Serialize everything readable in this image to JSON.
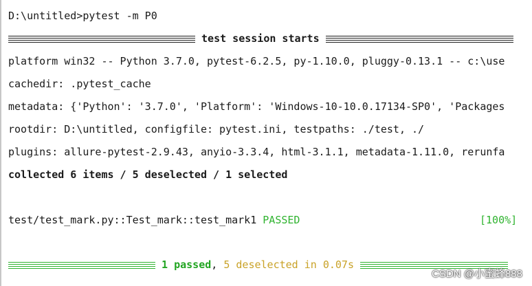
{
  "terminal": {
    "prompt_line": "D:\\untitled>pytest -m P0",
    "session_header": "test session starts",
    "platform_line": "platform win32 -- Python 3.7.0, pytest-6.2.5, py-1.10.0, pluggy-0.13.1 -- c:\\use",
    "cachedir_line": "cachedir: .pytest_cache",
    "metadata_line": "metadata: {'Python': '3.7.0', 'Platform': 'Windows-10-10.0.17134-SP0', 'Packages",
    "rootdir_line": "rootdir: D:\\untitled, configfile: pytest.ini, testpaths: ./test, ./",
    "plugins_line": "plugins: allure-pytest-2.9.43, anyio-3.3.4, html-3.1.1, metadata-1.11.0, rerunfa",
    "collected_line": "collected 6 items / 5 deselected / 1 selected",
    "test_name": "test/test_mark.py::Test_mark::test_mark1",
    "test_status": "PASSED",
    "test_percent": "[100%]",
    "summary_passed": "1 passed",
    "summary_comma": ",",
    "summary_rest": "5 deselected in 0.07s"
  },
  "watermark": "CSDN @小蜜蜂888",
  "colors": {
    "pass_green": "#2fb32f",
    "deselect_yellow": "#c9a227",
    "text": "#1a1a1a"
  }
}
